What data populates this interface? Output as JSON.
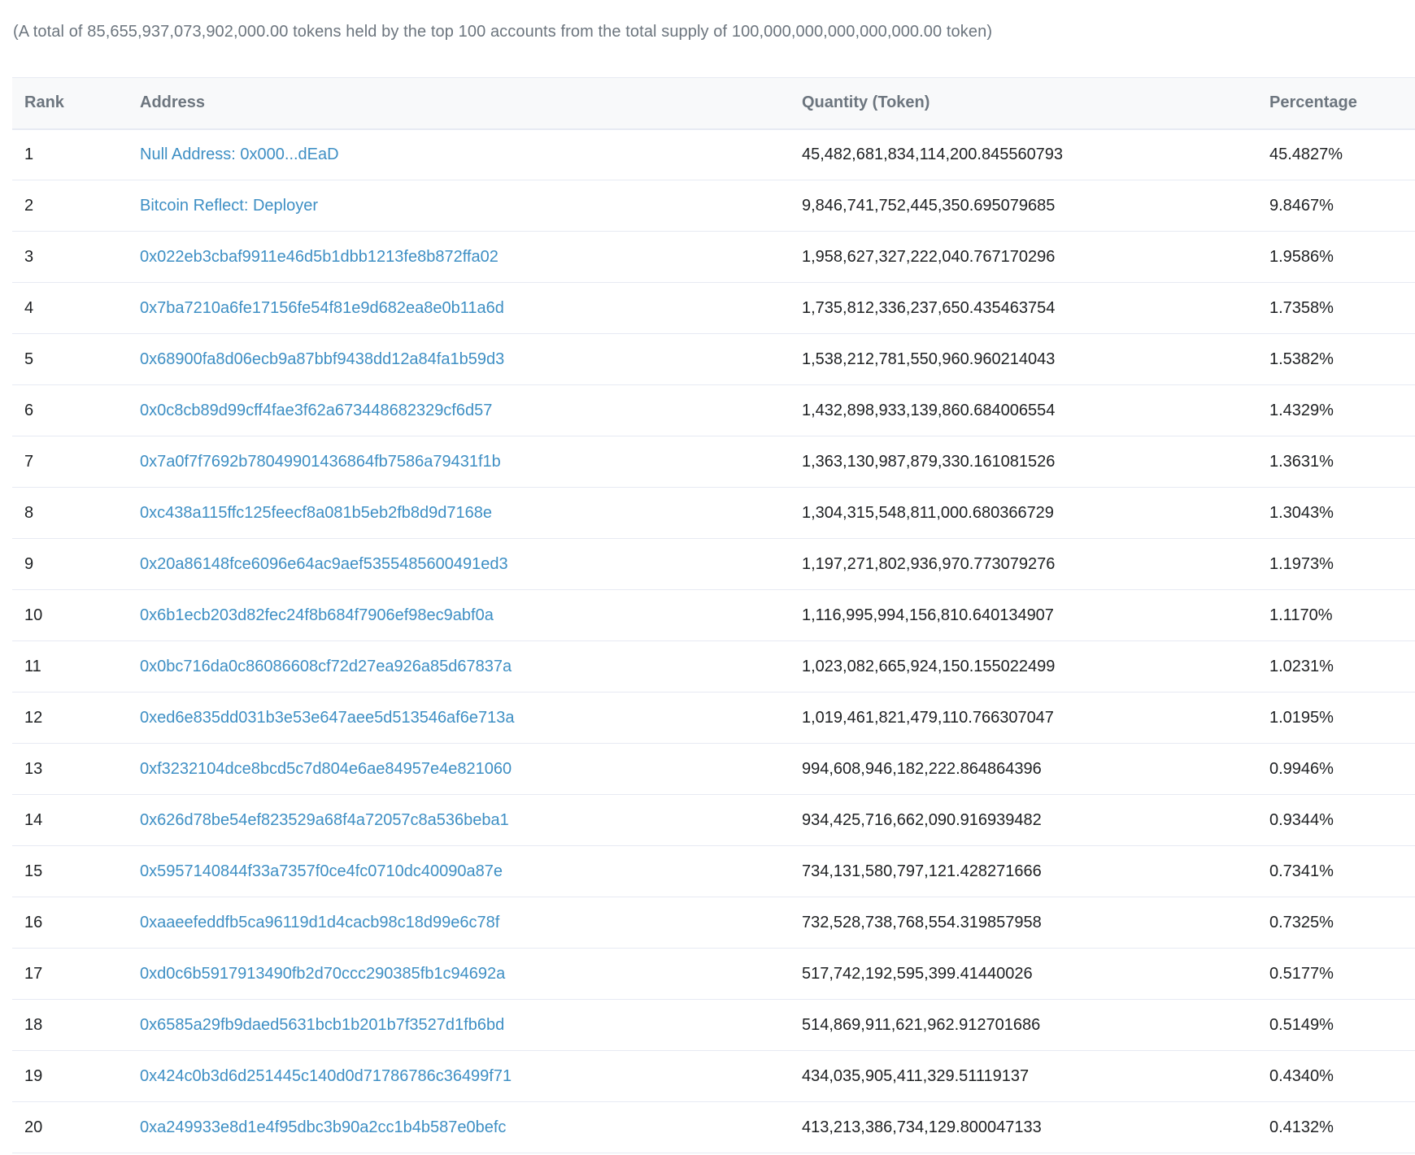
{
  "summary": "(A total of 85,655,937,073,902,000.00 tokens held by the top 100 accounts from the total supply of 100,000,000,000,000,000.00 token)",
  "table": {
    "headers": {
      "rank": "Rank",
      "address": "Address",
      "quantity": "Quantity (Token)",
      "percentage": "Percentage"
    },
    "rows": [
      {
        "rank": "1",
        "address": "Null Address: 0x000...dEaD",
        "quantity": "45,482,681,834,114,200.845560793",
        "percentage": "45.4827%"
      },
      {
        "rank": "2",
        "address": "Bitcoin Reflect: Deployer",
        "quantity": "9,846,741,752,445,350.695079685",
        "percentage": "9.8467%"
      },
      {
        "rank": "3",
        "address": "0x022eb3cbaf9911e46d5b1dbb1213fe8b872ffa02",
        "quantity": "1,958,627,327,222,040.767170296",
        "percentage": "1.9586%"
      },
      {
        "rank": "4",
        "address": "0x7ba7210a6fe17156fe54f81e9d682ea8e0b11a6d",
        "quantity": "1,735,812,336,237,650.435463754",
        "percentage": "1.7358%"
      },
      {
        "rank": "5",
        "address": "0x68900fa8d06ecb9a87bbf9438dd12a84fa1b59d3",
        "quantity": "1,538,212,781,550,960.960214043",
        "percentage": "1.5382%"
      },
      {
        "rank": "6",
        "address": "0x0c8cb89d99cff4fae3f62a673448682329cf6d57",
        "quantity": "1,432,898,933,139,860.684006554",
        "percentage": "1.4329%"
      },
      {
        "rank": "7",
        "address": "0x7a0f7f7692b78049901436864fb7586a79431f1b",
        "quantity": "1,363,130,987,879,330.161081526",
        "percentage": "1.3631%"
      },
      {
        "rank": "8",
        "address": "0xc438a115ffc125feecf8a081b5eb2fb8d9d7168e",
        "quantity": "1,304,315,548,811,000.680366729",
        "percentage": "1.3043%"
      },
      {
        "rank": "9",
        "address": "0x20a86148fce6096e64ac9aef5355485600491ed3",
        "quantity": "1,197,271,802,936,970.773079276",
        "percentage": "1.1973%"
      },
      {
        "rank": "10",
        "address": "0x6b1ecb203d82fec24f8b684f7906ef98ec9abf0a",
        "quantity": "1,116,995,994,156,810.640134907",
        "percentage": "1.1170%"
      },
      {
        "rank": "11",
        "address": "0x0bc716da0c86086608cf72d27ea926a85d67837a",
        "quantity": "1,023,082,665,924,150.155022499",
        "percentage": "1.0231%"
      },
      {
        "rank": "12",
        "address": "0xed6e835dd031b3e53e647aee5d513546af6e713a",
        "quantity": "1,019,461,821,479,110.766307047",
        "percentage": "1.0195%"
      },
      {
        "rank": "13",
        "address": "0xf3232104dce8bcd5c7d804e6ae84957e4e821060",
        "quantity": "994,608,946,182,222.864864396",
        "percentage": "0.9946%"
      },
      {
        "rank": "14",
        "address": "0x626d78be54ef823529a68f4a72057c8a536beba1",
        "quantity": "934,425,716,662,090.916939482",
        "percentage": "0.9344%"
      },
      {
        "rank": "15",
        "address": "0x5957140844f33a7357f0ce4fc0710dc40090a87e",
        "quantity": "734,131,580,797,121.428271666",
        "percentage": "0.7341%"
      },
      {
        "rank": "16",
        "address": "0xaaeefeddfb5ca96119d1d4cacb98c18d99e6c78f",
        "quantity": "732,528,738,768,554.319857958",
        "percentage": "0.7325%"
      },
      {
        "rank": "17",
        "address": "0xd0c6b5917913490fb2d70ccc290385fb1c94692a",
        "quantity": "517,742,192,595,399.41440026",
        "percentage": "0.5177%"
      },
      {
        "rank": "18",
        "address": "0x6585a29fb9daed5631bcb1b201b7f3527d1fb6bd",
        "quantity": "514,869,911,621,962.912701686",
        "percentage": "0.5149%"
      },
      {
        "rank": "19",
        "address": "0x424c0b3d6d251445c140d0d71786786c36499f71",
        "quantity": "434,035,905,411,329.51119137",
        "percentage": "0.4340%"
      },
      {
        "rank": "20",
        "address": "0xa249933e8d1e4f95dbc3b90a2cc1b4b587e0befc",
        "quantity": "413,213,386,734,129.800047133",
        "percentage": "0.4132%"
      }
    ]
  }
}
